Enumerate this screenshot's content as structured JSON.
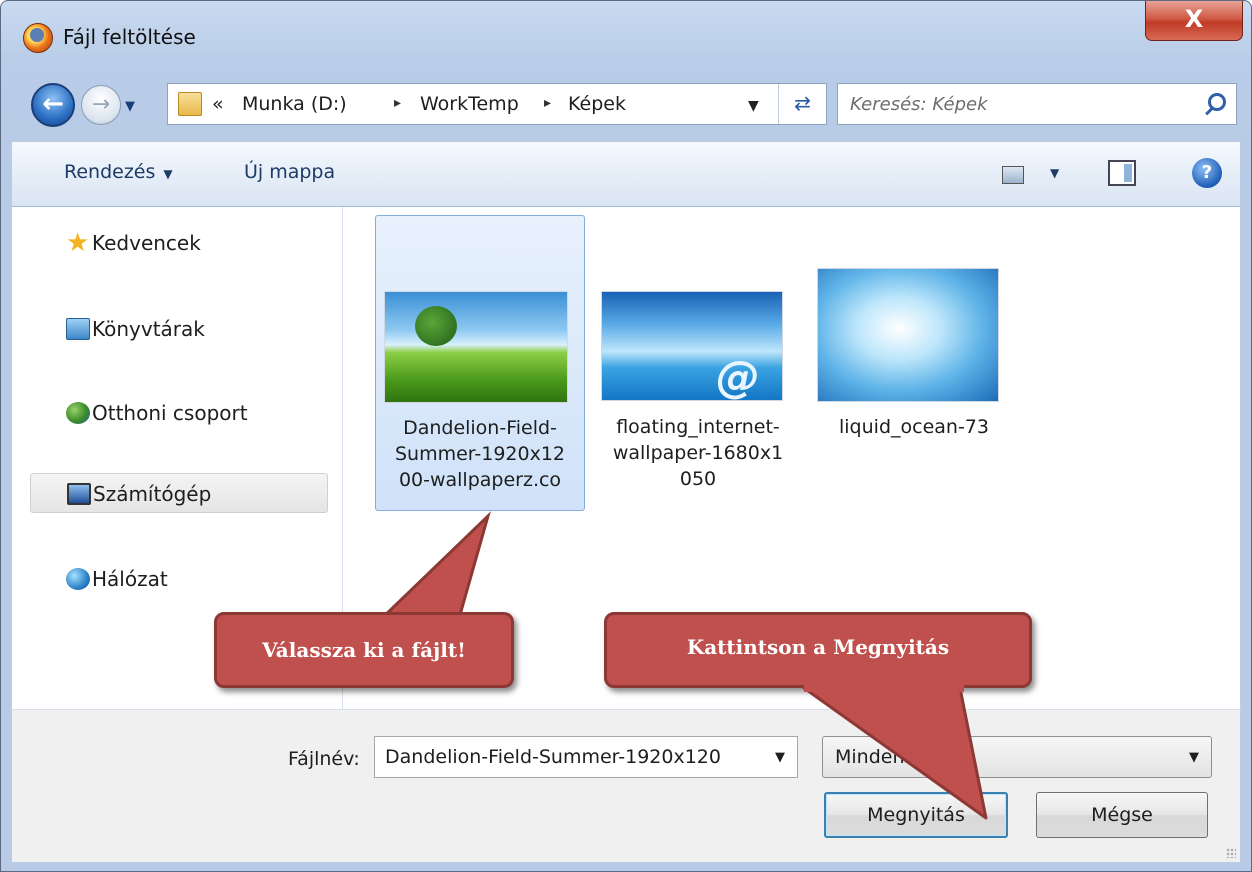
{
  "window": {
    "title": "Fájl feltöltése",
    "close_label": "X"
  },
  "address": {
    "overflow": "«",
    "breadcrumbs": [
      "Munka (D:)",
      "WorkTemp",
      "Képek"
    ],
    "separator": "▸"
  },
  "search": {
    "placeholder": "Keresés: Képek"
  },
  "toolbar": {
    "organize_label": "Rendezés",
    "new_folder_label": "Új mappa",
    "help_label": "?"
  },
  "sidebar": {
    "items": [
      {
        "label": "Kedvencek",
        "icon": "star-icon"
      },
      {
        "label": "Könyvtárak",
        "icon": "library-icon"
      },
      {
        "label": "Otthoni csoport",
        "icon": "homegroup-icon"
      },
      {
        "label": "Számítógép",
        "icon": "computer-icon",
        "selected": true
      },
      {
        "label": "Hálózat",
        "icon": "network-icon"
      }
    ]
  },
  "files": [
    {
      "line1": "Dandelion-Field-",
      "line2": "Summer-1920x12",
      "line3": "00-wallpaperz.co",
      "selected": true
    },
    {
      "line1": "floating_internet-",
      "line2": "wallpaper-1680x1",
      "line3": "050",
      "selected": false
    },
    {
      "line1": "liquid_ocean-73",
      "line2": "",
      "line3": "",
      "selected": false
    }
  ],
  "footer": {
    "filename_label": "Fájlnév:",
    "filename_value": "Dandelion-Field-Summer-1920x120",
    "filetype_value": "Minden f",
    "open_label": "Megnyitás",
    "cancel_label": "Mégse"
  },
  "callouts": {
    "select_file": "Válassza ki a fájlt!",
    "click_open": "Kattintson a Megnyitás"
  },
  "colors": {
    "callout_fill": "#c0504d",
    "callout_border": "#8c3835",
    "selection": "#cfe2f9"
  }
}
